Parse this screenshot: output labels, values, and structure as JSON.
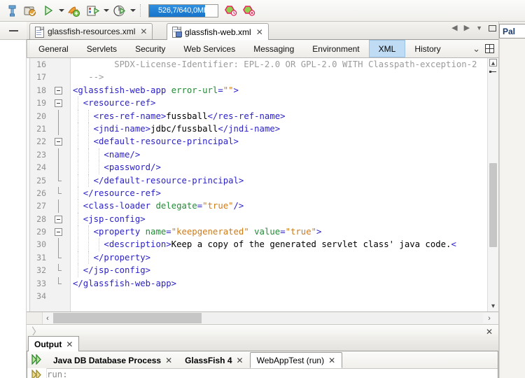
{
  "toolbar": {
    "buttons": [
      {
        "name": "new-file-button",
        "icon": "new-file-icon"
      },
      {
        "name": "new-project-button",
        "icon": "new-project-icon"
      },
      {
        "name": "run-project-button",
        "icon": "run-icon"
      },
      {
        "name": "debug-project-button",
        "icon": "debug-icon"
      },
      {
        "name": "profile-project-button",
        "icon": "profile-icon"
      },
      {
        "name": "test-project-button",
        "icon": "test-icon"
      }
    ],
    "memory_label": "526,7/640,0MB",
    "memory_percent": 82,
    "memory_bar_color": "#1673c9",
    "garbage_collect_icons": [
      "gc-icon-1",
      "gc-icon-2"
    ]
  },
  "left_strip": {
    "minimize_label": "—"
  },
  "editor": {
    "document_tabs": [
      {
        "label": "glassfish-resources.xml",
        "active": false,
        "close": "✕",
        "icon": "xml-file-icon"
      },
      {
        "label": "glassfish-web.xml",
        "active": true,
        "close": "✕",
        "icon": "glassfish-web-xml-file-icon"
      }
    ],
    "window_controls": {
      "scroll_left": "◀",
      "scroll_right": "▶",
      "dropdown": "▼",
      "maximize": "maximize-icon"
    },
    "view_tabs": [
      {
        "label": "General",
        "selected": false
      },
      {
        "label": "Servlets",
        "selected": false
      },
      {
        "label": "Security",
        "selected": false
      },
      {
        "label": "Web Services",
        "selected": false
      },
      {
        "label": "Messaging",
        "selected": false
      },
      {
        "label": "Environment",
        "selected": false
      },
      {
        "label": "XML",
        "selected": true
      },
      {
        "label": "History",
        "selected": false
      }
    ],
    "view_tabs_right": {
      "overflow": "⌄",
      "grid": "grid-icon"
    },
    "selected_tab_color": "#bfdcf4",
    "lines": [
      {
        "num": "16",
        "fold": "none",
        "indent": 0,
        "parts": [
          {
            "t": "cmt",
            "s": "        SPDX-License-Identifier: EPL-2.0 OR GPL-2.0 WITH Classpath-exception-2"
          }
        ]
      },
      {
        "num": "17",
        "fold": "none",
        "indent": 0,
        "parts": [
          {
            "t": "cmt",
            "s": "   -->"
          }
        ]
      },
      {
        "num": "18",
        "fold": "box",
        "indent": 0,
        "parts": [
          {
            "t": "tag",
            "s": "<glassfish-web-app "
          },
          {
            "t": "attr",
            "s": "error-url"
          },
          {
            "t": "tag",
            "s": "="
          },
          {
            "t": "val",
            "s": "\"\""
          },
          {
            "t": "tag",
            "s": ">"
          }
        ]
      },
      {
        "num": "19",
        "fold": "box",
        "indent": 1,
        "parts": [
          {
            "t": "tag",
            "s": "  <resource-ref>"
          }
        ]
      },
      {
        "num": "20",
        "fold": "line",
        "indent": 2,
        "parts": [
          {
            "t": "tag",
            "s": "    <res-ref-name>"
          },
          {
            "t": "txt",
            "s": "fussball"
          },
          {
            "t": "tag",
            "s": "</res-ref-name>"
          }
        ]
      },
      {
        "num": "21",
        "fold": "line",
        "indent": 2,
        "parts": [
          {
            "t": "tag",
            "s": "    <jndi-name>"
          },
          {
            "t": "txt",
            "s": "jdbc/fussball"
          },
          {
            "t": "tag",
            "s": "</jndi-name>"
          }
        ]
      },
      {
        "num": "22",
        "fold": "box",
        "indent": 2,
        "parts": [
          {
            "t": "tag",
            "s": "    <default-resource-principal>"
          }
        ]
      },
      {
        "num": "23",
        "fold": "line",
        "indent": 3,
        "parts": [
          {
            "t": "tag",
            "s": "      <name/>"
          }
        ]
      },
      {
        "num": "24",
        "fold": "line",
        "indent": 3,
        "parts": [
          {
            "t": "tag",
            "s": "      <password/>"
          }
        ]
      },
      {
        "num": "25",
        "fold": "end",
        "indent": 2,
        "parts": [
          {
            "t": "tag",
            "s": "    </default-resource-principal>"
          }
        ]
      },
      {
        "num": "26",
        "fold": "end",
        "indent": 1,
        "parts": [
          {
            "t": "tag",
            "s": "  </resource-ref>"
          }
        ]
      },
      {
        "num": "27",
        "fold": "line",
        "indent": 1,
        "parts": [
          {
            "t": "tag",
            "s": "  <class-loader "
          },
          {
            "t": "attr",
            "s": "delegate"
          },
          {
            "t": "tag",
            "s": "="
          },
          {
            "t": "val",
            "s": "\"true\""
          },
          {
            "t": "tag",
            "s": "/>"
          }
        ]
      },
      {
        "num": "28",
        "fold": "box",
        "indent": 1,
        "parts": [
          {
            "t": "tag",
            "s": "  <jsp-config>"
          }
        ]
      },
      {
        "num": "29",
        "fold": "box",
        "indent": 2,
        "parts": [
          {
            "t": "tag",
            "s": "    <property "
          },
          {
            "t": "attr",
            "s": "name"
          },
          {
            "t": "tag",
            "s": "="
          },
          {
            "t": "val",
            "s": "\"keepgenerated\""
          },
          {
            "t": "tag",
            "s": " "
          },
          {
            "t": "attr",
            "s": "value"
          },
          {
            "t": "tag",
            "s": "="
          },
          {
            "t": "val",
            "s": "\"true\""
          },
          {
            "t": "tag",
            "s": ">"
          }
        ]
      },
      {
        "num": "30",
        "fold": "line",
        "indent": 3,
        "parts": [
          {
            "t": "tag",
            "s": "      <description>"
          },
          {
            "t": "txt",
            "s": "Keep a copy of the generated servlet class' java code."
          },
          {
            "t": "tag",
            "s": "<"
          }
        ]
      },
      {
        "num": "31",
        "fold": "end",
        "indent": 2,
        "parts": [
          {
            "t": "tag",
            "s": "    </property>"
          }
        ]
      },
      {
        "num": "32",
        "fold": "end",
        "indent": 1,
        "parts": [
          {
            "t": "tag",
            "s": "  </jsp-config>"
          }
        ]
      },
      {
        "num": "33",
        "fold": "end",
        "indent": 0,
        "parts": [
          {
            "t": "tag",
            "s": "</glassfish-web-app>"
          }
        ]
      },
      {
        "num": "34",
        "fold": "none",
        "indent": 0,
        "parts": [
          {
            "t": "txt",
            "s": ""
          }
        ]
      }
    ],
    "scroll": {
      "up_arrow": "▴",
      "down_arrow": "▾",
      "left_arrow": "‹",
      "right_arrow": "›"
    },
    "breadcrumb": {
      "chevron": "〉",
      "close": "✕"
    }
  },
  "palette": {
    "title": "Pal"
  },
  "output": {
    "window_tab": {
      "label": "Output",
      "close": "✕"
    },
    "io_tabs": [
      {
        "label": "Java DB Database Process",
        "close": "✕",
        "selected": false,
        "bold": true
      },
      {
        "label": "GlassFish 4",
        "close": "✕",
        "selected": false,
        "bold": true
      },
      {
        "label": "WebAppTest (run)",
        "close": "✕",
        "selected": true,
        "bold": false
      }
    ],
    "text": "run:"
  }
}
